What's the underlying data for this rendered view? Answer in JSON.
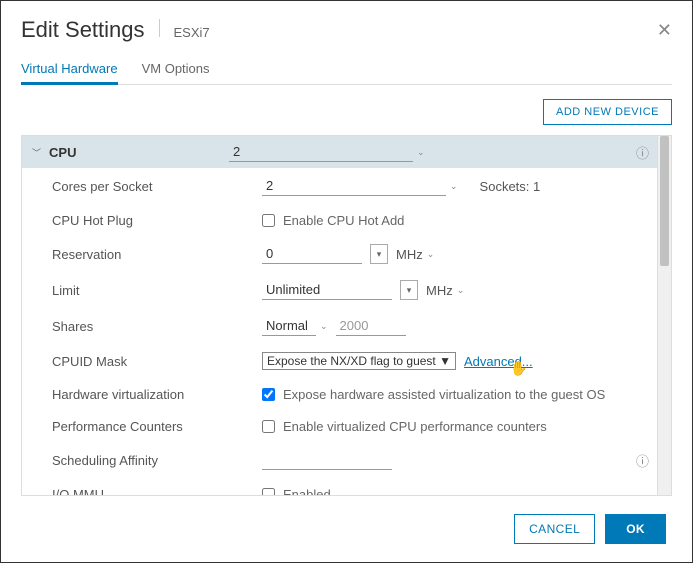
{
  "header": {
    "title": "Edit Settings",
    "subtitle": "ESXi7"
  },
  "tabs": {
    "hardware": "Virtual Hardware",
    "options": "VM Options"
  },
  "actions": {
    "add_device": "ADD NEW DEVICE"
  },
  "cpu_section": {
    "title": "CPU",
    "value": "2",
    "rows": {
      "cores_label": "Cores per Socket",
      "cores_value": "2",
      "sockets_text": "Sockets: 1",
      "hotplug_label": "CPU Hot Plug",
      "hotplug_check_label": "Enable CPU Hot Add",
      "reservation_label": "Reservation",
      "reservation_value": "0",
      "reservation_unit": "MHz",
      "limit_label": "Limit",
      "limit_value": "Unlimited",
      "limit_unit": "MHz",
      "shares_label": "Shares",
      "shares_mode": "Normal",
      "shares_value": "2000",
      "cpuid_label": "CPUID Mask",
      "cpuid_value": "Expose the NX/XD flag to guest ▼",
      "cpuid_advanced": "Advanced...",
      "hwvirt_label": "Hardware virtualization",
      "hwvirt_check_label": "Expose hardware assisted virtualization to the guest OS",
      "perfcnt_label": "Performance Counters",
      "perfcnt_check_label": "Enable virtualized CPU performance counters",
      "sched_label": "Scheduling Affinity",
      "sched_value": "",
      "iommu_label": "I/O MMU",
      "iommu_check_label": "Enabled"
    }
  },
  "footer": {
    "cancel": "CANCEL",
    "ok": "OK"
  }
}
